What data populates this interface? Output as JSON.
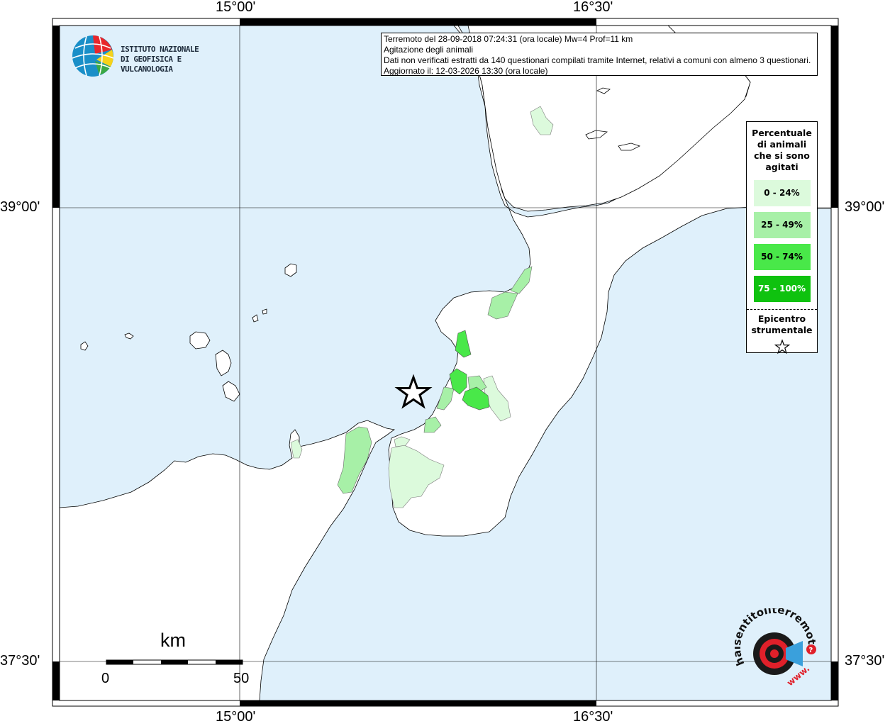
{
  "coordinates": {
    "lon_left": "15°00'",
    "lon_right": "16°30'",
    "lat_top": "39°00'",
    "lat_bottom": "37°30'"
  },
  "info": {
    "line1": "Terremoto del 28-09-2018 07:24:31 (ora locale) Mw=4 Prof=11 km",
    "line2": "Agitazione degli animali",
    "line3": "Dati non verificati estratti da 140 questionari compilati tramite Internet, relativi a comuni con almeno 3 questionari.",
    "line4": "Aggiornato il: 12-03-2026 13:30 (ora locale)"
  },
  "logo": {
    "line1": "ISTITUTO NAZIONALE",
    "line2": "DI GEOFISICA E VULCANOLOGIA"
  },
  "legend": {
    "title": "Percentuale di animali che si sono agitati",
    "items": [
      {
        "label": "0 - 24%",
        "color": "#dcfadc"
      },
      {
        "label": "25 - 49%",
        "color": "#a7f0a7"
      },
      {
        "label": "50 - 74%",
        "color": "#49e849"
      },
      {
        "label": "75 - 100%",
        "color": "#0fc20f"
      }
    ],
    "epicentro": "Epicentro strumentale"
  },
  "scale": {
    "unit": "km",
    "start": "0",
    "end": "50"
  },
  "hsit_logo": {
    "text": "haisentitoilterremoto.it",
    "prefix": "www."
  },
  "colors": {
    "sea": "#dff0fb",
    "land": "#ffffff",
    "epicenter": "#000000"
  }
}
